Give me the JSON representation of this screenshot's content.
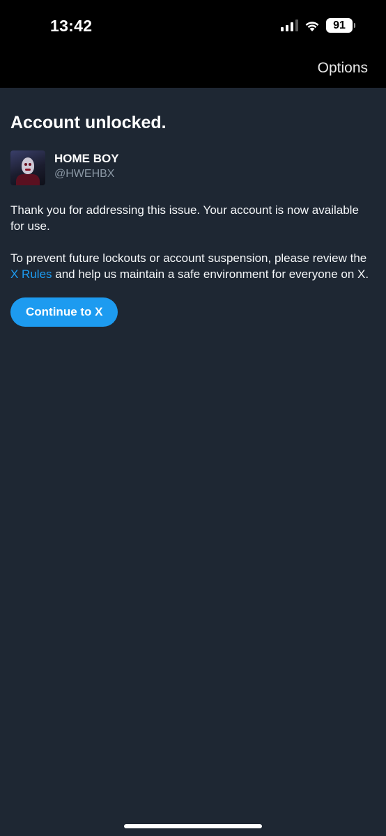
{
  "status_bar": {
    "time": "13:42",
    "battery": "91",
    "icons": [
      "cellular-signal-icon",
      "wifi-icon",
      "battery-icon"
    ]
  },
  "nav": {
    "options_label": "Options"
  },
  "main": {
    "title": "Account unlocked.",
    "user": {
      "display_name": "HOME BOY",
      "handle": "@HWEHBX"
    },
    "paragraph1": "Thank you for addressing this issue. Your account is now available for use.",
    "paragraph2_before": "To prevent future lockouts or account suspension, please review the ",
    "paragraph2_link": "X Rules",
    "paragraph2_after": " and help us maintain a safe environment for everyone on X.",
    "continue_label": "Continue to X"
  },
  "colors": {
    "background": "#1e2733",
    "top_bar": "#000000",
    "accent": "#1d9bf0",
    "secondary_text": "#8b98a5"
  }
}
